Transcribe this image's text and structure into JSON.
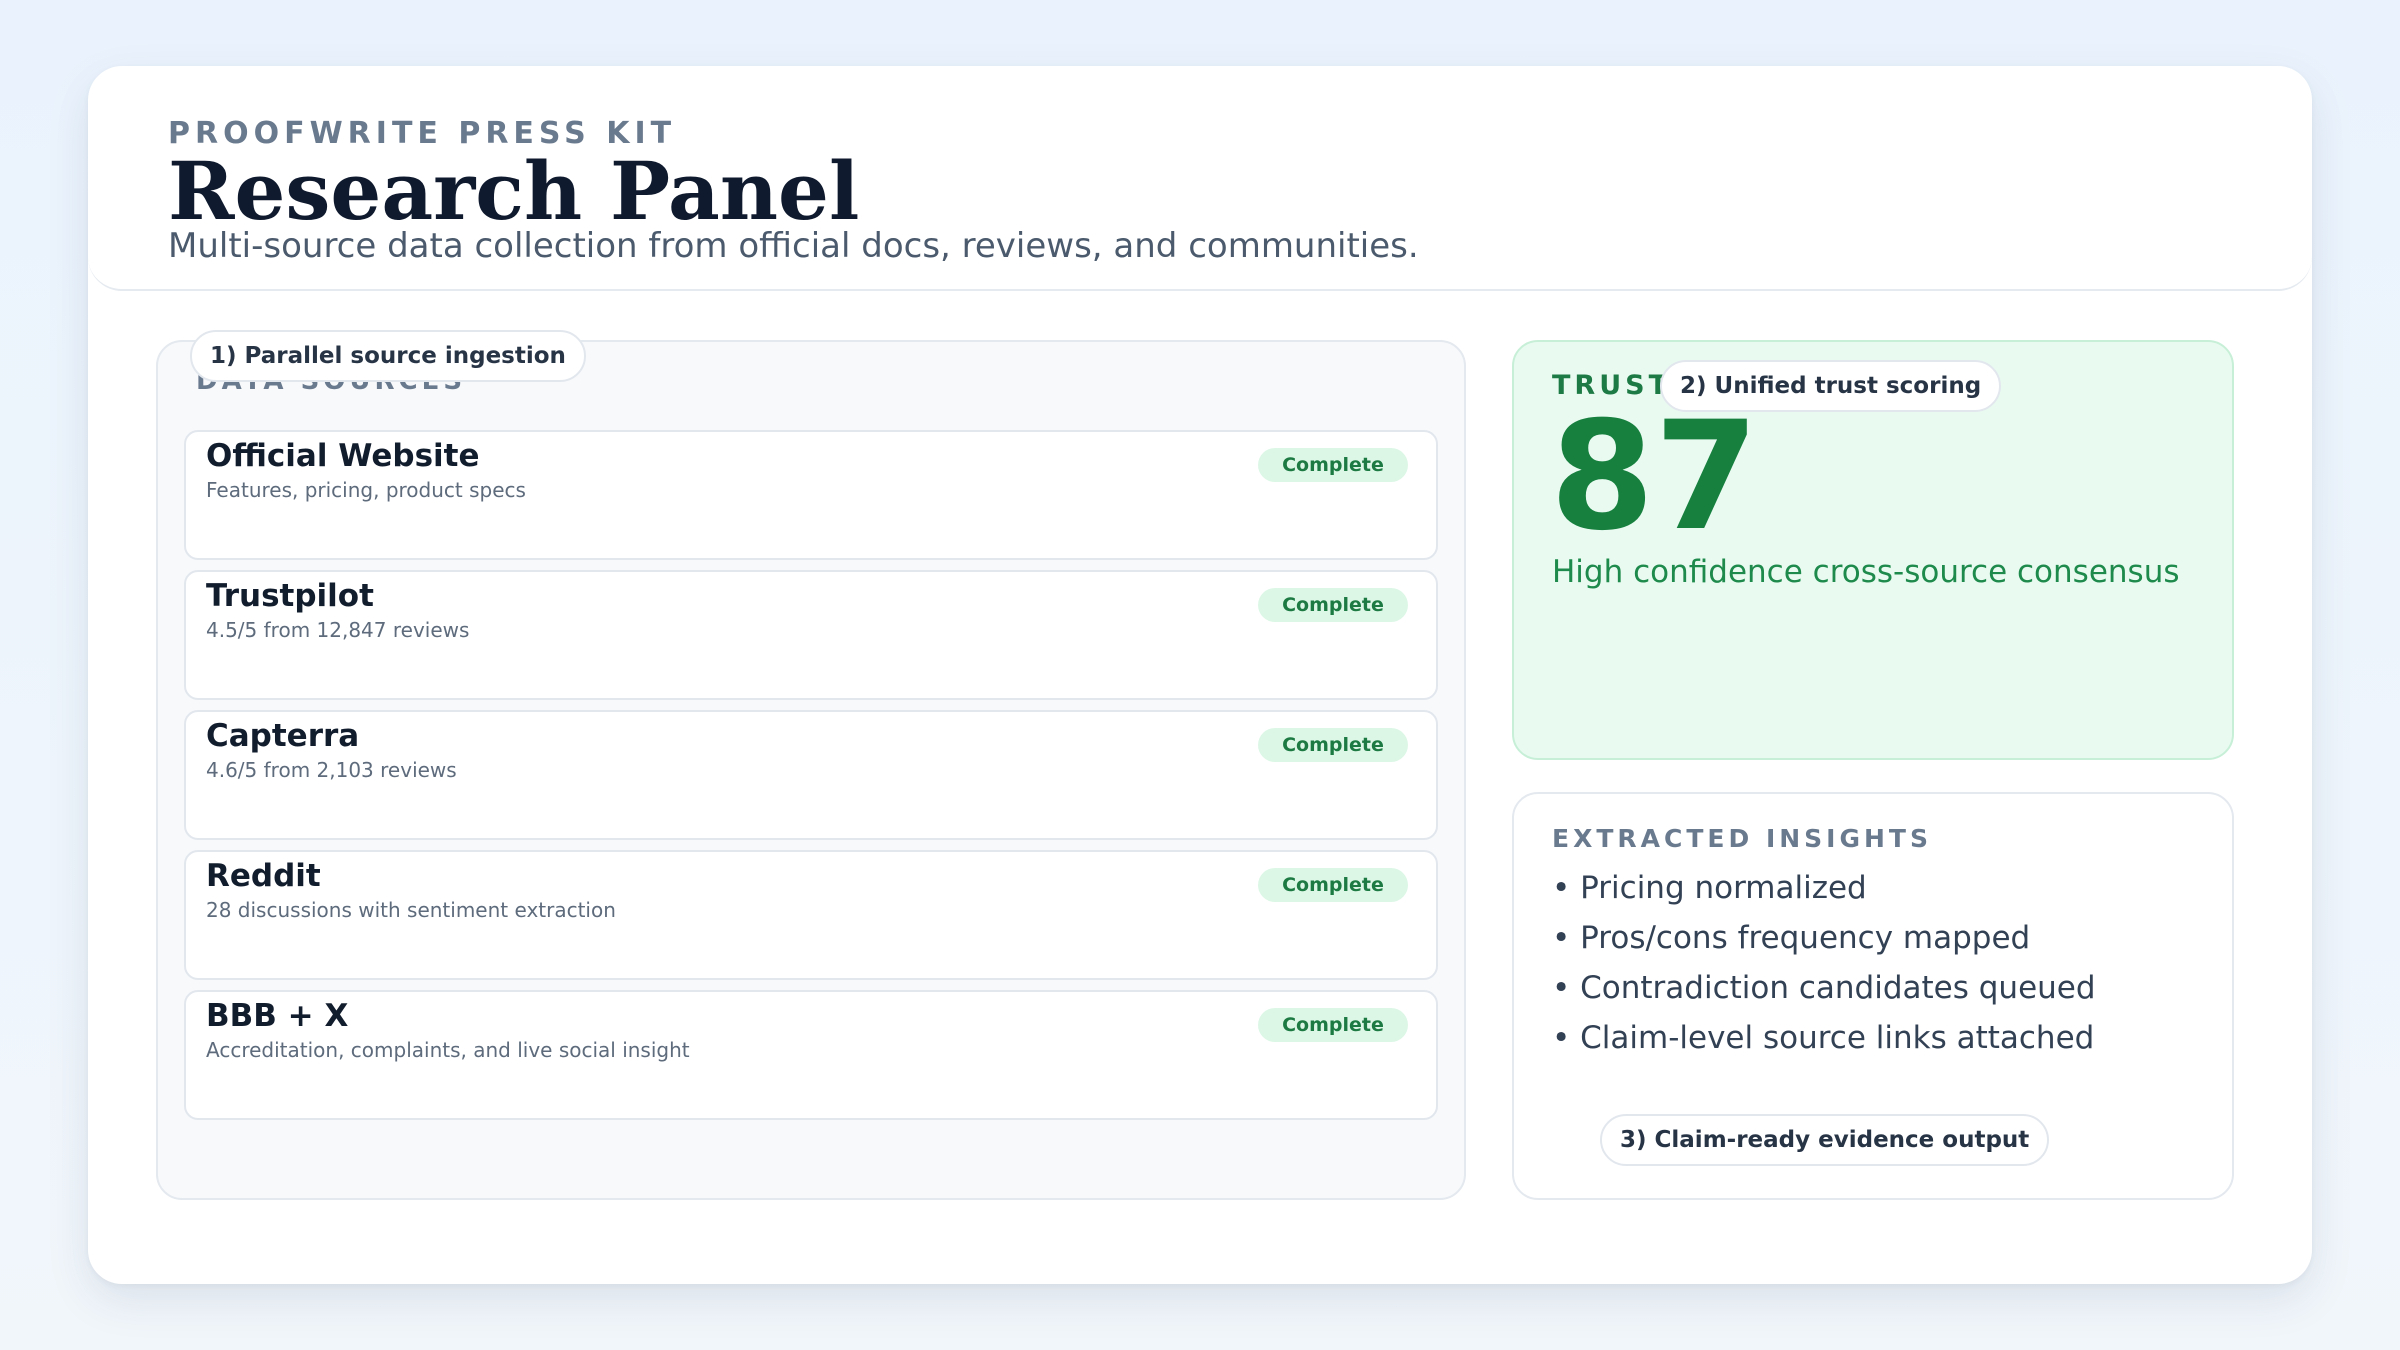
{
  "header": {
    "kicker": "PROOFWRITE PRESS KIT",
    "title": "Research Panel",
    "subtitle": "Multi-source data collection from official docs, reviews, and communities."
  },
  "sources": {
    "label": "DATA SOURCES",
    "step_pill": "1) Parallel source ingestion",
    "items": [
      {
        "name": "Official Website",
        "desc": "Features, pricing, product specs",
        "status": "Complete"
      },
      {
        "name": "Trustpilot",
        "desc": "4.5/5 from 12,847 reviews",
        "status": "Complete"
      },
      {
        "name": "Capterra",
        "desc": "4.6/5 from 2,103 reviews",
        "status": "Complete"
      },
      {
        "name": "Reddit",
        "desc": "28 discussions with sentiment extraction",
        "status": "Complete"
      },
      {
        "name": "BBB + X",
        "desc": "Accreditation, complaints, and live social insight",
        "status": "Complete"
      }
    ]
  },
  "trust": {
    "label": "TRUST",
    "step_pill": "2) Unified trust scoring",
    "score": "87",
    "caption": "High confidence cross-source consensus"
  },
  "insights": {
    "label": "EXTRACTED INSIGHTS",
    "items": [
      "• Pricing normalized",
      "• Pros/cons frequency mapped",
      "• Contradiction candidates queued",
      "• Claim-level source links attached"
    ],
    "step_pill": "3) Claim-ready evidence output"
  },
  "colors": {
    "accent_green": "#17803f",
    "badge_bg": "#dcf7e6",
    "trust_bg": "#e9fbf1",
    "title_ink": "#0f1a2e"
  }
}
